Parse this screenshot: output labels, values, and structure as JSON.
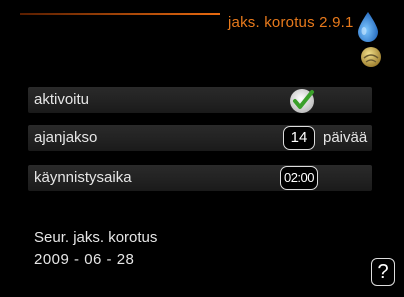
{
  "header": {
    "title": "jaks. korotus 2.9.1",
    "accent_color": "#e87a1c",
    "icons": [
      "water-drop-icon",
      "ball-icon"
    ]
  },
  "settings": {
    "rows": [
      {
        "label": "aktivoitu",
        "control": "checkbox",
        "checked": true,
        "icon": "checkmark-icon"
      },
      {
        "label": "ajanjakso",
        "value": "14",
        "unit": "päivää"
      },
      {
        "label": "käynnistysaika",
        "value": "02:00"
      }
    ]
  },
  "next": {
    "label": "Seur. jaks. korotus",
    "date": "2009 - 06 - 28"
  },
  "help": {
    "label": "?",
    "icon": "help-icon"
  }
}
